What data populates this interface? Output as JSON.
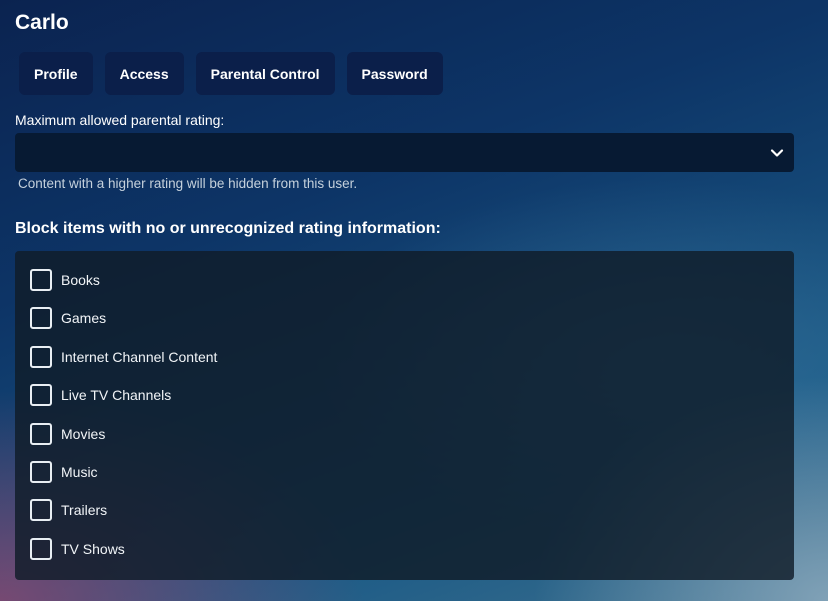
{
  "page": {
    "title": "Carlo"
  },
  "tabs": [
    {
      "label": "Profile"
    },
    {
      "label": "Access"
    },
    {
      "label": "Parental Control"
    },
    {
      "label": "Password"
    }
  ],
  "rating": {
    "label": "Maximum allowed parental rating:",
    "selected_value": "",
    "help_text": "Content with a higher rating will be hidden from this user."
  },
  "block": {
    "heading": "Block items with no or unrecognized rating information:",
    "items": [
      {
        "label": "Books",
        "checked": false
      },
      {
        "label": "Games",
        "checked": false
      },
      {
        "label": "Internet Channel Content",
        "checked": false
      },
      {
        "label": "Live TV Channels",
        "checked": false
      },
      {
        "label": "Movies",
        "checked": false
      },
      {
        "label": "Music",
        "checked": false
      },
      {
        "label": "Trailers",
        "checked": false
      },
      {
        "label": "TV Shows",
        "checked": false
      }
    ]
  }
}
